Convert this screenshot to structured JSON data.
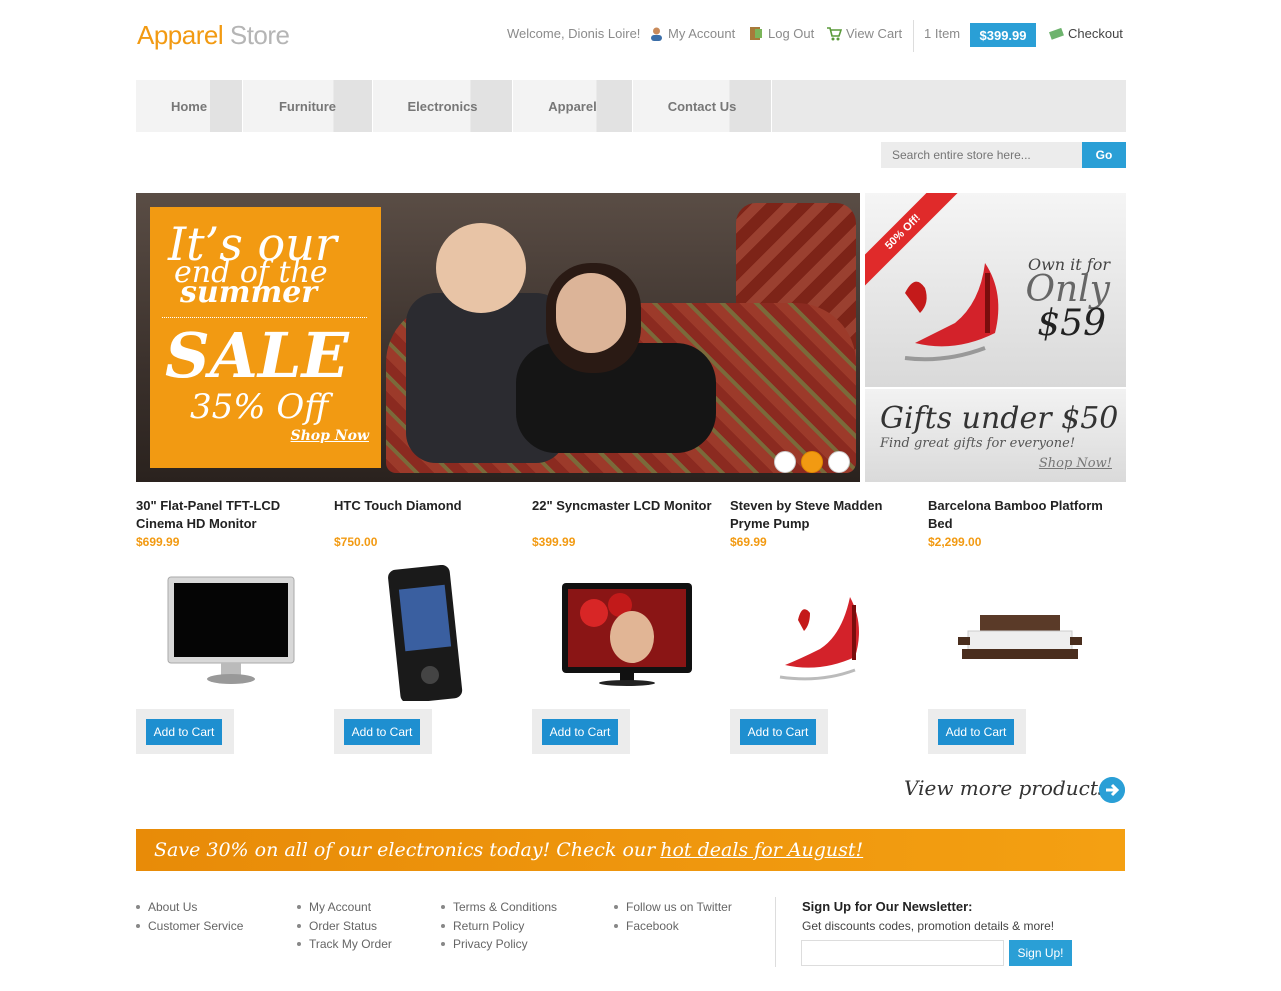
{
  "logo": {
    "part1": "Apparel",
    "part2": "Store"
  },
  "top_links": {
    "welcome": "Welcome, Dionis Loire!",
    "my_account": "My Account",
    "log_out": "Log Out",
    "view_cart": "View Cart",
    "item_count": "1 Item",
    "cart_total": "$399.99",
    "checkout": "Checkout"
  },
  "nav": [
    "Home",
    "Furniture",
    "Electronics",
    "Apparel",
    "Contact Us"
  ],
  "search": {
    "placeholder": "Search entire store here...",
    "button": "Go"
  },
  "hero": {
    "line1": "It’s our",
    "line2": "end of the",
    "line3": "summer",
    "line4": "SALE",
    "line5": "35% Off",
    "shop_now": "Shop Now"
  },
  "side_promo_1": {
    "ribbon": "50% Off!",
    "t1": "Own it for",
    "t2": "Only",
    "t3": "$59"
  },
  "side_promo_2": {
    "title": "Gifts under $50",
    "subtitle": "Find great gifts for everyone!",
    "link": "Shop Now!"
  },
  "products": [
    {
      "name": "30\" Flat-Panel TFT-LCD Cinema HD Monitor",
      "price": "$699.99",
      "button": "Add to Cart",
      "icon": "monitor-icon"
    },
    {
      "name": "HTC Touch Diamond",
      "price": "$750.00",
      "button": "Add to Cart",
      "icon": "phone-icon"
    },
    {
      "name": "22\" Syncmaster LCD Monitor",
      "price": "$399.99",
      "button": "Add to Cart",
      "icon": "monitor-icon"
    },
    {
      "name": "Steven by Steve Madden Pryme Pump",
      "price": "$69.99",
      "button": "Add to Cart",
      "icon": "shoe-icon"
    },
    {
      "name": "Barcelona Bamboo Platform Bed",
      "price": "$2,299.00",
      "button": "Add to Cart",
      "icon": "bed-icon"
    }
  ],
  "view_more": "View more products!",
  "banner": {
    "text": "Save 30% on all of our electronics today! Check our",
    "link": "hot deals for August!"
  },
  "footer": {
    "col1": [
      "About Us",
      "Customer Service"
    ],
    "col2": [
      "My Account",
      "Order Status",
      "Track My Order"
    ],
    "col3": [
      "Terms & Conditions",
      "Return Policy",
      "Privacy Policy"
    ],
    "col4": [
      "Follow us on Twitter",
      "Facebook"
    ]
  },
  "newsletter": {
    "title": "Sign Up for Our Newsletter:",
    "subtitle": "Get discounts codes, promotion details & more!",
    "button": "Sign Up!"
  },
  "colors": {
    "accent_orange": "#f29a12",
    "accent_blue": "#2a9fd6"
  }
}
